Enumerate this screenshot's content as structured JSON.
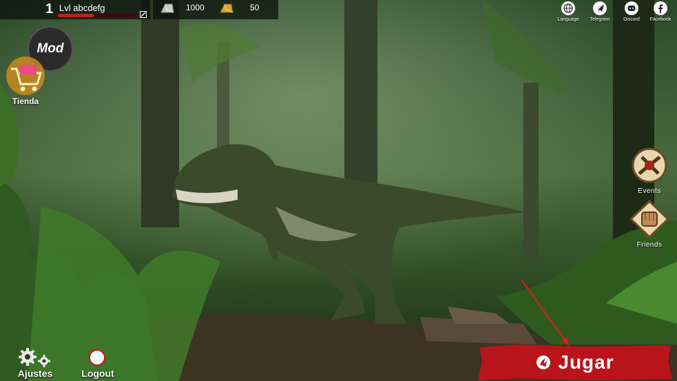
{
  "profile": {
    "level": "1",
    "lvl_prefix": "Lvl",
    "username": "abcdefg",
    "xp_fraction": 0.45
  },
  "currency": {
    "silver": "1000",
    "gold": "50"
  },
  "mod_label": "Mod",
  "shop_label": "Tienda",
  "social": [
    {
      "label": "Language",
      "icon": "globe-icon"
    },
    {
      "label": "Telegram",
      "icon": "telegram-icon"
    },
    {
      "label": "Discord",
      "icon": "discord-icon"
    },
    {
      "label": "Facebook",
      "icon": "facebook-icon"
    }
  ],
  "events_label": "Events",
  "friends_label": "Friends",
  "settings_label": "Ajustes",
  "logout_label": "Logout",
  "play_label": "Jugar",
  "colors": {
    "play": "#b9141a",
    "jungle": "#1d3a1a",
    "accent": "#c9a14a"
  }
}
